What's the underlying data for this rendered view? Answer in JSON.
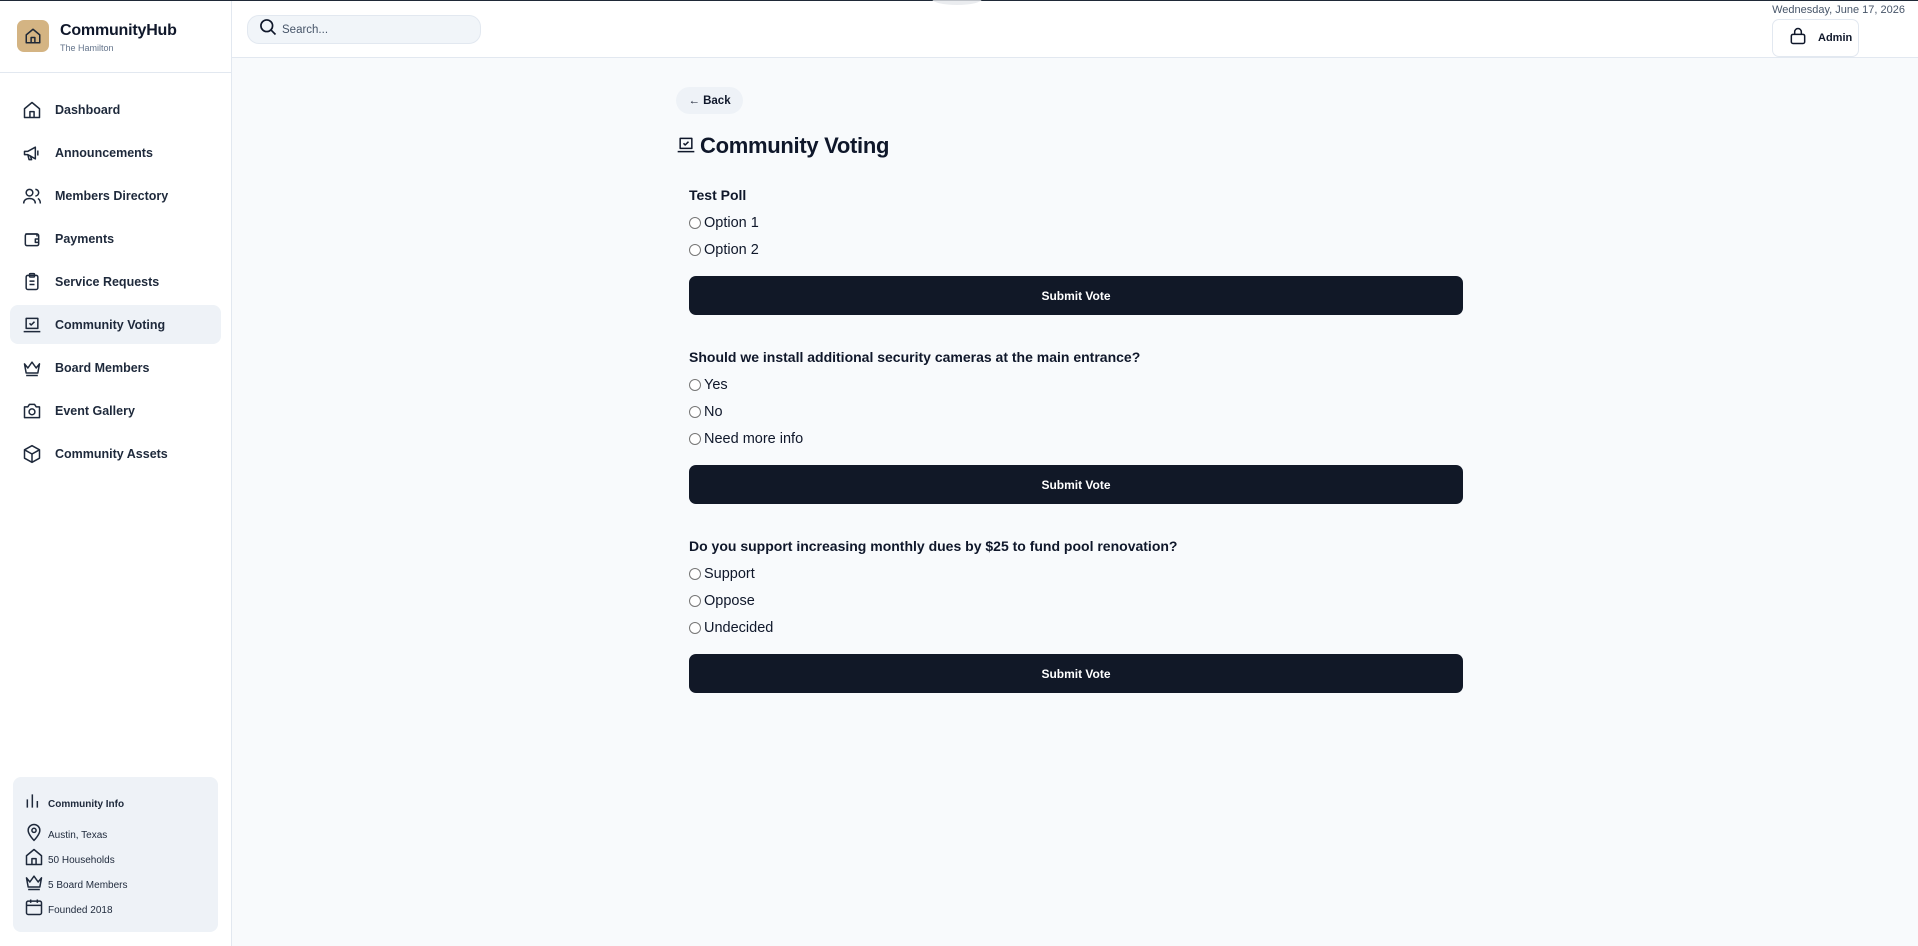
{
  "brand": {
    "name": "CommunityHub",
    "subtitle": "The Hamilton",
    "logo_color": "#d4b483"
  },
  "header": {
    "search_placeholder": "Search...",
    "date": "Wednesday, June 17, 2026",
    "user_label": "Admin"
  },
  "sidebar": {
    "items": [
      {
        "label": "Dashboard",
        "icon": "home-icon",
        "active": false
      },
      {
        "label": "Announcements",
        "icon": "megaphone-icon",
        "active": false
      },
      {
        "label": "Members Directory",
        "icon": "users-icon",
        "active": false
      },
      {
        "label": "Payments",
        "icon": "wallet-icon",
        "active": false
      },
      {
        "label": "Service Requests",
        "icon": "clipboard-icon",
        "active": false
      },
      {
        "label": "Community Voting",
        "icon": "vote-icon",
        "active": true
      },
      {
        "label": "Board Members",
        "icon": "crown-icon",
        "active": false
      },
      {
        "label": "Event Gallery",
        "icon": "camera-icon",
        "active": false
      },
      {
        "label": "Community Assets",
        "icon": "box-icon",
        "active": false
      }
    ],
    "info": {
      "title": "Community Info",
      "location": "Austin, Texas",
      "households": "50 Households",
      "board": "5 Board Members",
      "founded": "Founded 2018"
    }
  },
  "main": {
    "back_label": "← Back",
    "title": "Community Voting",
    "submit_label": "Submit Vote",
    "polls": [
      {
        "question": "Test Poll",
        "options": [
          "Option 1",
          "Option 2"
        ]
      },
      {
        "question": "Should we install additional security cameras at the main entrance?",
        "options": [
          "Yes",
          "No",
          "Need more info"
        ]
      },
      {
        "question": "Do you support increasing monthly dues by $25 to fund pool renovation?",
        "options": [
          "Support",
          "Oppose",
          "Undecided"
        ]
      }
    ]
  },
  "colors": {
    "primary": "#111827",
    "accent": "#d4b483",
    "active_bg": "#eef2f7"
  }
}
